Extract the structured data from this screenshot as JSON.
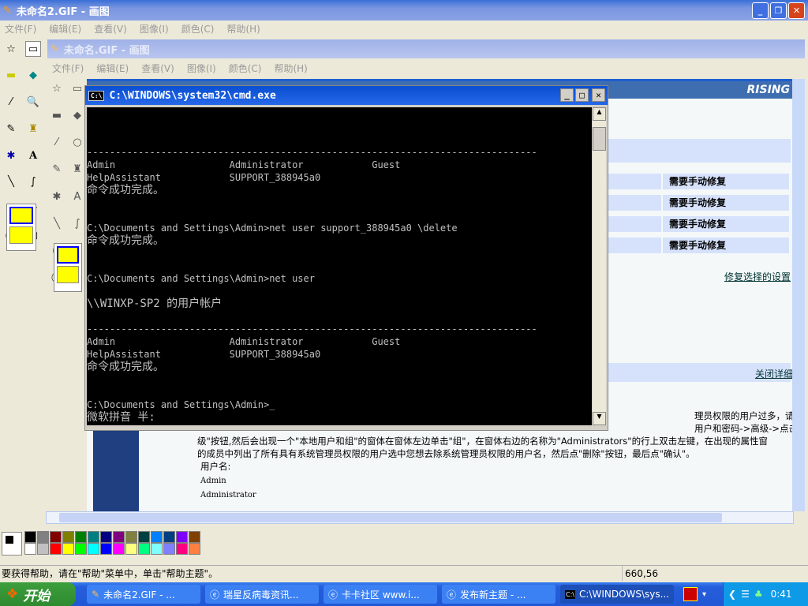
{
  "outer_window": {
    "title": "未命名2.GIF - 画图",
    "menu": [
      "文件(F)",
      "编辑(E)",
      "查看(V)",
      "图像(I)",
      "颜色(C)",
      "帮助(H)"
    ]
  },
  "inner_window": {
    "title": "未命名.GIF - 画图",
    "menu": [
      "文件(F)",
      "编辑(E)",
      "查看(V)",
      "图像(I)",
      "颜色(C)",
      "帮助(H)"
    ]
  },
  "cmd": {
    "title": "C:\\WINDOWS\\system32\\cmd.exe",
    "lines": [
      "-------------------------------------------------------------------------------",
      "Admin                    Administrator            Guest",
      "HelpAssistant            SUPPORT_388945a0",
      "命令成功完成。",
      "",
      "",
      "C:\\Documents and Settings\\Admin>net user support_388945a0 \\delete",
      "命令成功完成。",
      "",
      "",
      "C:\\Documents and Settings\\Admin>net user",
      "",
      "\\\\WINXP-SP2 的用户帐户",
      "",
      "-------------------------------------------------------------------------------",
      "Admin                    Administrator            Guest",
      "HelpAssistant            SUPPORT_388945a0",
      "命令成功完成。",
      "",
      "",
      "C:\\Documents and Settings\\Admin>_"
    ],
    "ime": "微软拼音 半:"
  },
  "web": {
    "logo": "RISING",
    "fix_labels": [
      "需要手动修复",
      "需要手动修复",
      "需要手动修复",
      "需要手动修复"
    ],
    "fix_link": "修复选择的设置",
    "close_link": "关闭详细",
    "para": [
      "理员权限的用户过多，请您确认这些具有系统",
      "用户和密码->高级->点击\"高级用户管理\"中的",
      "级\"按钮,然后会出现一个\"本地用户和组\"的窗体在窗体左边单击\"组\"，在窗体右边的名称为\"Administrators\"的行上双击左键，在出现的属性窗",
      "的成员中列出了所有具有系统管理员权限的用户选中您想去除系统管理员权限的用户名，然后点\"删除\"按钮，最后点\"确认\"。"
    ],
    "user_label": "用户名:",
    "users": [
      "Admin",
      "Administrator"
    ]
  },
  "palette": [
    "#000000",
    "#808080",
    "#800000",
    "#808000",
    "#008000",
    "#008080",
    "#000080",
    "#800080",
    "#808040",
    "#004040",
    "#0080ff",
    "#004080",
    "#8000ff",
    "#804000",
    "#ffffff",
    "#c0c0c0",
    "#ff0000",
    "#ffff00",
    "#00ff00",
    "#00ffff",
    "#0000ff",
    "#ff00ff",
    "#ffff80",
    "#00ff80",
    "#80ffff",
    "#8080ff",
    "#ff0080",
    "#ff8040"
  ],
  "status": {
    "help": "要获得帮助，请在\"帮助\"菜单中，单击\"帮助主题\"。",
    "coords": "660,56"
  },
  "taskbar": {
    "start": "开始",
    "items": [
      "未命名2.GIF - ...",
      "瑞星反病毒资讯...",
      "卡卡社区 www.i...",
      "发布新主题 - ...",
      "C:\\WINDOWS\\sys..."
    ],
    "clock": "0:41"
  }
}
